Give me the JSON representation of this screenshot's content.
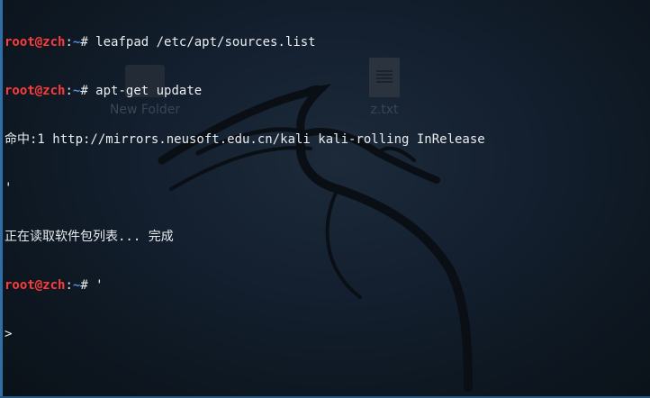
{
  "desktop": {
    "icons": [
      {
        "label": "New Folder",
        "icon": "folder-icon"
      },
      {
        "label": "z.txt",
        "icon": "text-file-icon"
      }
    ]
  },
  "terminal": {
    "prompt": {
      "user_host": "root@zch",
      "separator": ":",
      "path": "~",
      "symbol": "#"
    },
    "lines": [
      {
        "type": "command",
        "text": " leafpad /etc/apt/sources.list"
      },
      {
        "type": "command",
        "text": " apt-get update"
      },
      {
        "type": "output",
        "text": "命中:1 http://mirrors.neusoft.edu.cn/kali kali-rolling InRelease"
      },
      {
        "type": "output",
        "text": "'"
      },
      {
        "type": "output",
        "text": "正在读取软件包列表... 完成"
      },
      {
        "type": "command",
        "text": " '"
      },
      {
        "type": "output",
        "text": ">"
      }
    ]
  },
  "colors": {
    "prompt_user": "#ff3b3b",
    "prompt_path": "#4f8de0",
    "text": "#e9ecef",
    "background": "#142030"
  }
}
